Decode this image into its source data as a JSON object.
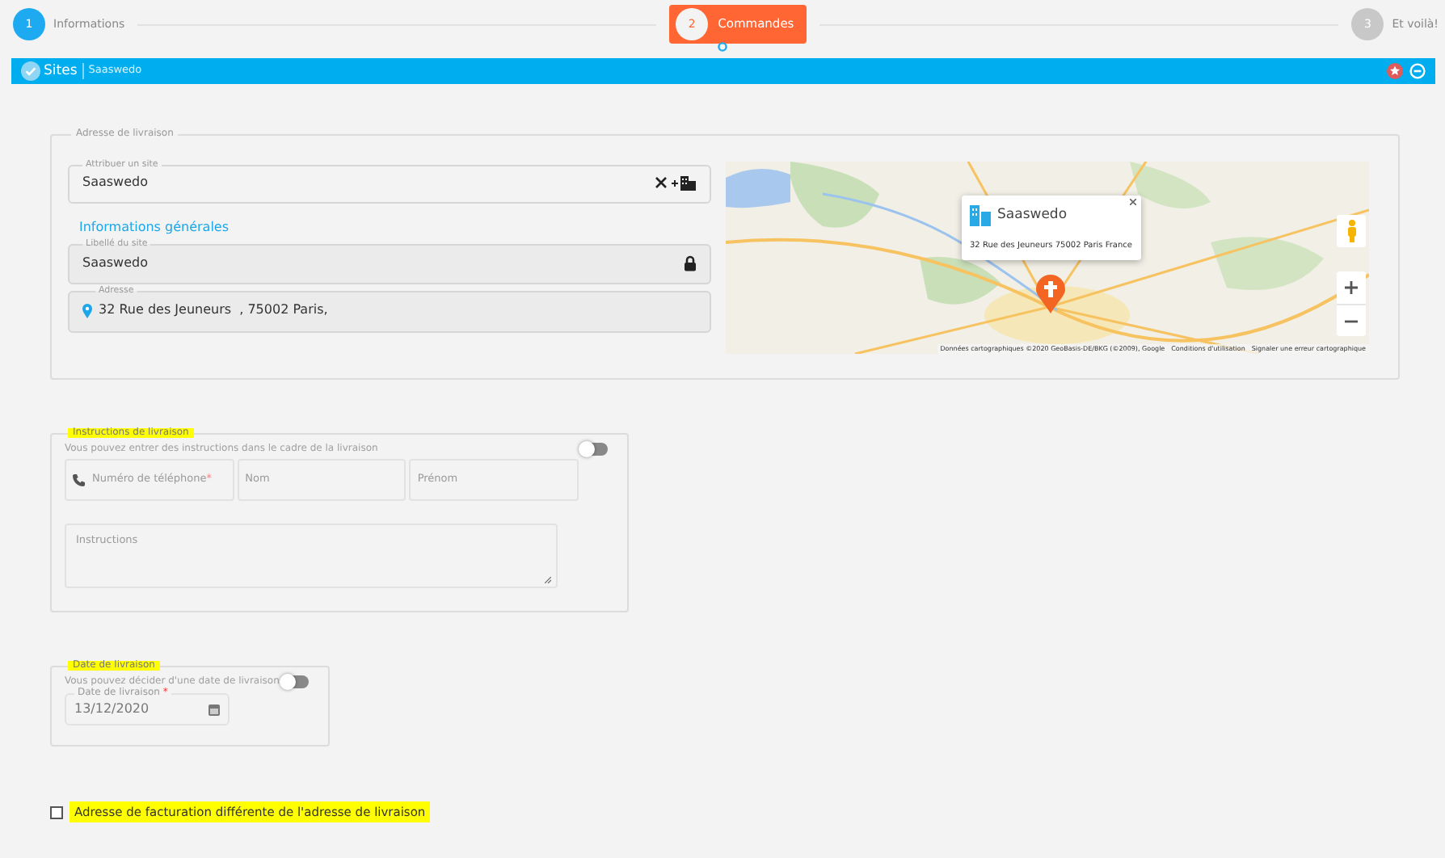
{
  "stepper": {
    "steps": [
      {
        "number": "1",
        "label": "Informations",
        "completed": true,
        "selected": false
      },
      {
        "number": "2",
        "label": "Commandes",
        "completed": false,
        "selected": true
      },
      {
        "number": "3",
        "label": "Et voilà!",
        "completed": false,
        "selected": false
      }
    ]
  },
  "panel": {
    "title": "Sites",
    "subtitle": "Saaswedo"
  },
  "delivery_address": {
    "legend": "Adresse de livraison",
    "site_field": {
      "label": "Attribuer un site",
      "value": "Saaswedo"
    },
    "section_link": "Informations générales",
    "site_name": {
      "label": "Libellé du site",
      "value": "Saaswedo",
      "locked": true
    },
    "address": {
      "label": "Adresse",
      "value": "32 Rue des Jeuneurs  , 75002 Paris,"
    },
    "map": {
      "popup": {
        "title": "Saaswedo",
        "address": "32 Rue des Jeuneurs 75002 Paris France"
      },
      "attribution": [
        "Données cartographiques ©2020 GeoBasis-DE/BKG (©2009), Google",
        "Conditions d'utilisation",
        "Signaler une erreur cartographique"
      ]
    }
  },
  "instructions": {
    "legend": "Instructions de livraison",
    "highlighted": true,
    "hint": "Vous pouvez entrer des instructions dans le cadre de la livraison",
    "on": false,
    "fields": [
      {
        "placeholder": "Numéro de téléphone",
        "required_mark": "*",
        "kind": "phone"
      },
      {
        "placeholder": "Nom",
        "kind": "text"
      },
      {
        "placeholder": "Prénom",
        "kind": "text"
      }
    ],
    "notes": {
      "placeholder": "Instructions"
    }
  },
  "delivery_date": {
    "legend": "Date de livraison",
    "highlighted": true,
    "hint": "Vous pouvez décider d'une date de livraison",
    "on": false,
    "field": {
      "label": "Date de livraison",
      "required_mark": "*",
      "value": "13/12/2020"
    }
  },
  "billing_checkbox": {
    "label": "Adresse de facturation différente de l'adresse de livraison",
    "checked": false,
    "highlighted": true
  }
}
